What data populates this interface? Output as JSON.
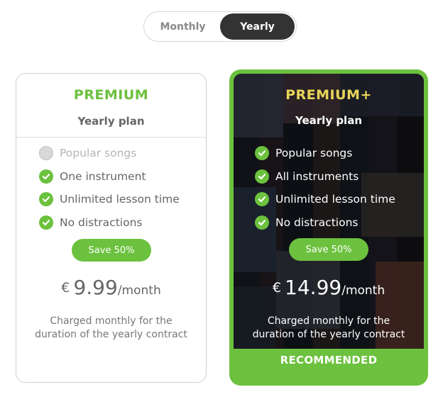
{
  "billing_toggle": {
    "monthly_label": "Monthly",
    "yearly_label": "Yearly",
    "selected": "Yearly"
  },
  "plans": [
    {
      "name": "PREMIUM",
      "subtitle": "Yearly plan",
      "features": [
        {
          "label": "Popular songs",
          "included": false
        },
        {
          "label": "One instrument",
          "included": true
        },
        {
          "label": "Unlimited lesson time",
          "included": true
        },
        {
          "label": "No distractions",
          "included": true
        }
      ],
      "badge": "Save 50%",
      "currency": "€",
      "amount": "9.99",
      "period": "/month",
      "note_line1": "Charged monthly for the",
      "note_line2": "duration of the yearly contract"
    },
    {
      "name": "PREMIUM+",
      "subtitle": "Yearly plan",
      "features": [
        {
          "label": "Popular songs",
          "included": true
        },
        {
          "label": "All instruments",
          "included": true
        },
        {
          "label": "Unlimited lesson time",
          "included": true
        },
        {
          "label": "No distractions",
          "included": true
        }
      ],
      "badge": "Save 50%",
      "currency": "€",
      "amount": "14.99",
      "period": "/month",
      "note_line1": "Charged monthly for the",
      "note_line2": "duration of the yearly contract",
      "footer": "RECOMMENDED"
    }
  ],
  "colors": {
    "accent_green": "#6cc13e",
    "premium_plus_gold": "#e8d55a",
    "toggle_active_bg": "#333333"
  },
  "icons": {
    "included": "check-circle-icon",
    "excluded": "empty-circle-icon"
  }
}
